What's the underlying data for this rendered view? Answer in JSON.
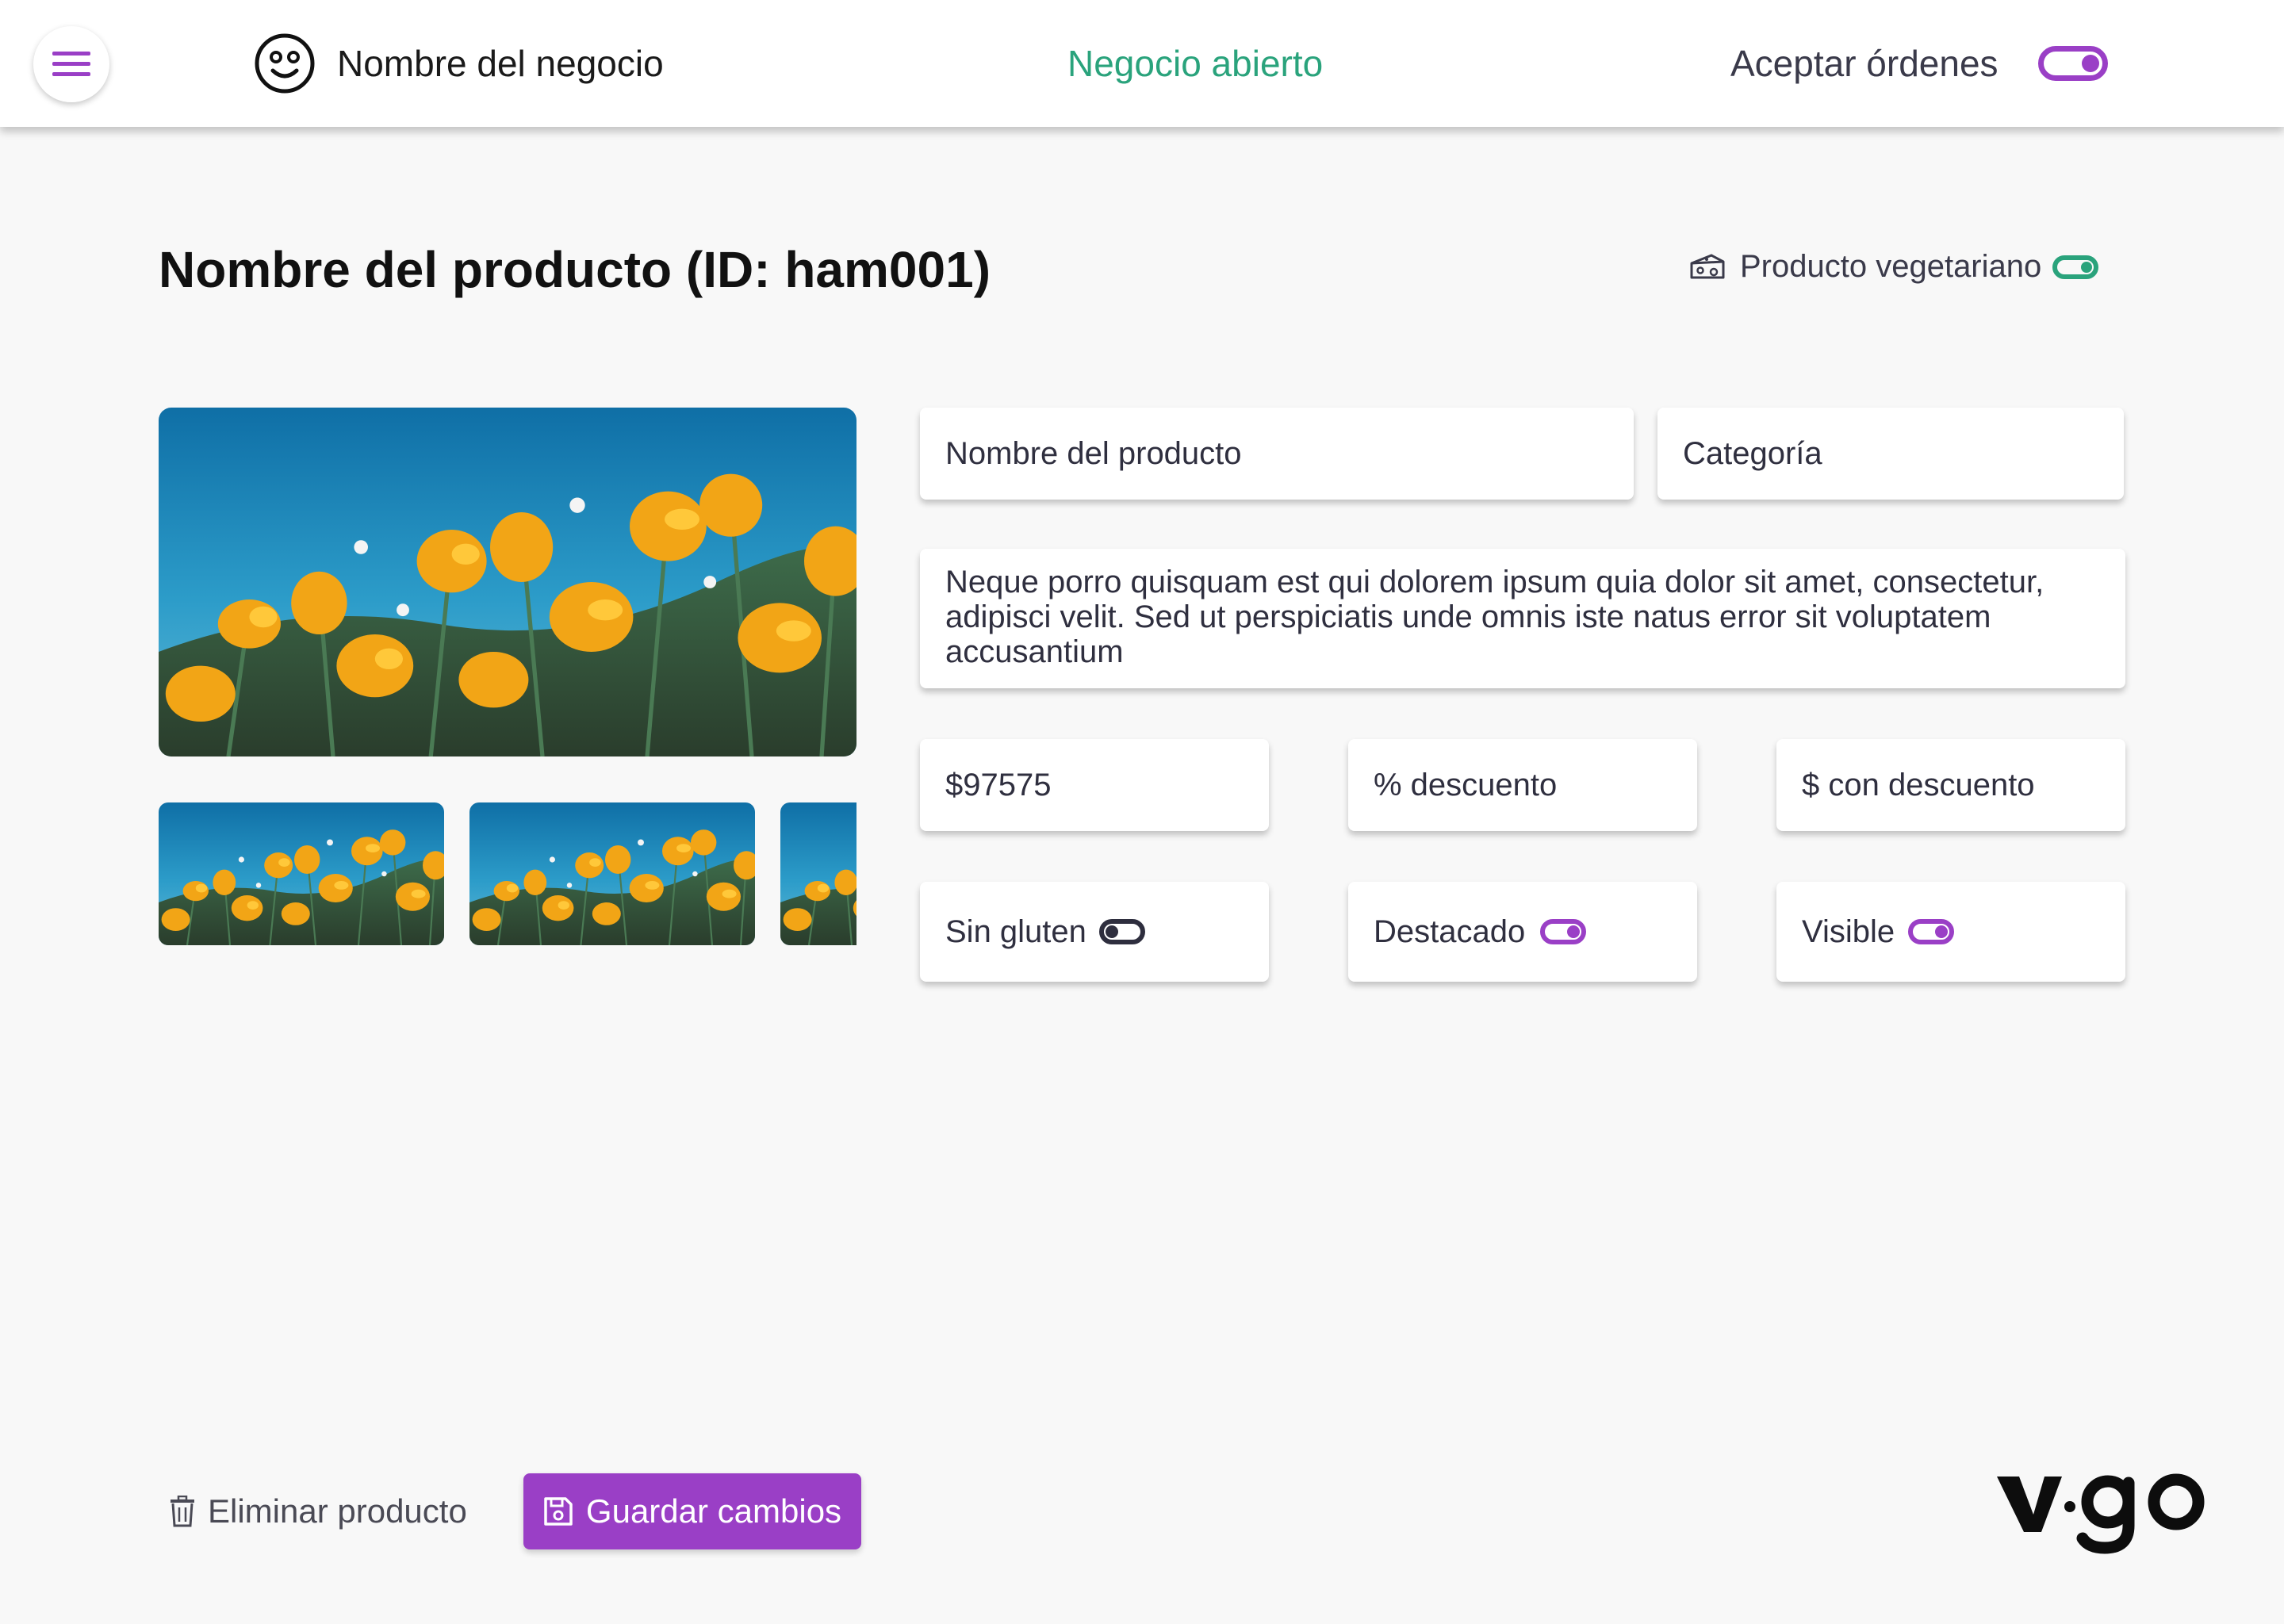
{
  "header": {
    "business_name": "Nombre del negocio",
    "business_status": "Negocio abierto",
    "accept_orders_label": "Aceptar órdenes",
    "accept_orders_on": true
  },
  "product": {
    "title": "Nombre del producto (ID: ham001)",
    "vegetarian_label": "Producto vegetariano",
    "vegetarian_on": true
  },
  "form": {
    "name_placeholder": "Nombre del producto",
    "category_placeholder": "Categoría",
    "description": "Neque porro quisquam est qui dolorem ipsum quia dolor sit amet, consectetur, adipisci velit. Sed ut perspiciatis unde omnis iste natus error sit voluptatem accusantium",
    "price": "$97575",
    "discount_placeholder": "% descuento",
    "discounted_price_placeholder": "$ con descuento",
    "gluten_free_label": "Sin gluten",
    "gluten_free_on": false,
    "featured_label": "Destacado",
    "featured_on": true,
    "visible_label": "Visible",
    "visible_on": true
  },
  "actions": {
    "delete_label": "Eliminar producto",
    "save_label": "Guardar cambios"
  },
  "colors": {
    "accent": "#9a3fc6",
    "status_green": "#2aa37c",
    "background": "#f8f8f8"
  },
  "icons": [
    "menu-icon",
    "smiley-icon",
    "cheese-icon",
    "trash-icon",
    "save-icon"
  ]
}
